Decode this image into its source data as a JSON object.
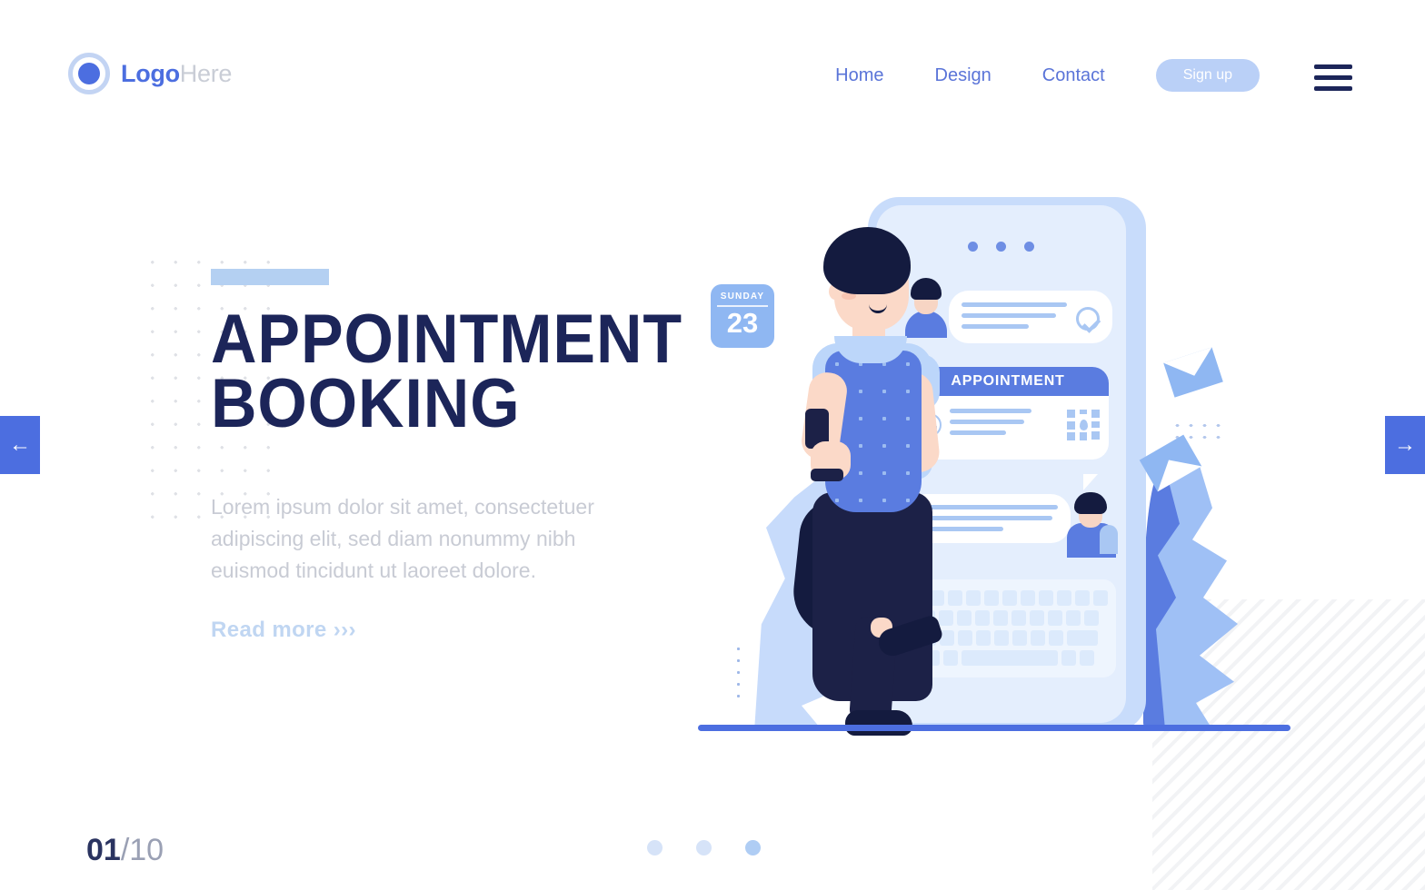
{
  "header": {
    "logo": {
      "primary": "Logo",
      "secondary": "Here",
      "icon": "logo-circle-icon"
    },
    "nav": [
      {
        "label": "Home"
      },
      {
        "label": "Design"
      },
      {
        "label": "Contact"
      }
    ],
    "signup_label": "Sign up",
    "menu_icon": "hamburger-menu-icon"
  },
  "hero": {
    "title_line1": "APPOINTMENT",
    "title_line2": "BOOKING",
    "subtitle": "Lorem ipsum dolor sit amet, consectetuer adipiscing elit, sed diam nonummy nibh euismod tincidunt ut laoreet dolore.",
    "read_more": "Read more ›››"
  },
  "carousel": {
    "prev_icon": "←",
    "next_icon": "→",
    "current": "01",
    "total": "/10",
    "dots": [
      {
        "active": false
      },
      {
        "active": false
      },
      {
        "active": true
      }
    ]
  },
  "illustration": {
    "calendar": {
      "day": "SUNDAY",
      "date": "23"
    },
    "phone": {
      "appointment_card_title": "APPOINTMENT",
      "icons": [
        "check-circle-icon",
        "clock-icon",
        "map-pin-icon",
        "keyboard-icon"
      ]
    },
    "envelopes": [
      "envelope-icon",
      "envelope-icon"
    ]
  },
  "colors": {
    "brand_blue": "#4c6ee0",
    "navy": "#1c2559",
    "light_blue": "#bad0f7",
    "accent_bar": "#b4d0f2",
    "muted_text": "#c8cbd4"
  }
}
